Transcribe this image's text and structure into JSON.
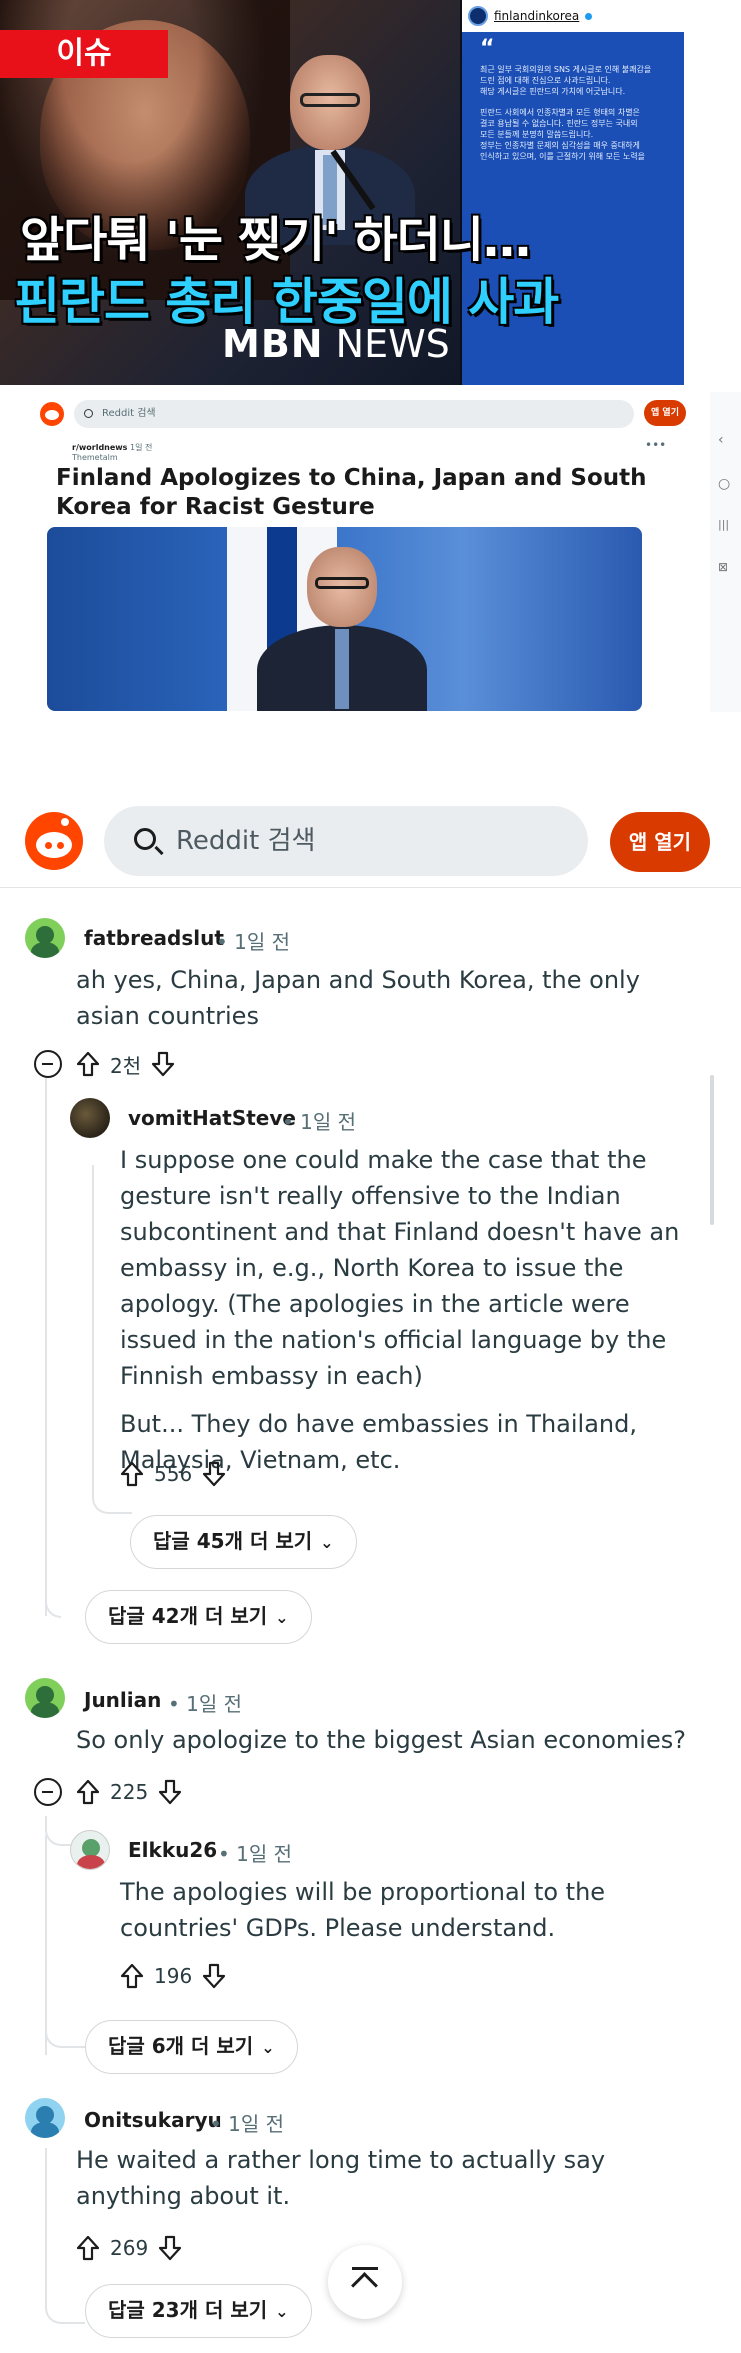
{
  "news_image": {
    "tag": "이슈",
    "account": "finlandinkorea",
    "quote_mark": "“",
    "statement_lines": [
      "최근 일부 국회의원의 SNS 게시글로 인해 불쾌감을",
      "드린 점에 대해 진심으로 사과드립니다.",
      "해당 게시글은 핀란드의 가치에 어긋납니다.",
      "핀란드 사회에서 인종차별과 모든 형태의 차별은",
      "결코 용납될 수 없습니다. 핀란드 정부는 국내외",
      "모든 분들께 분명히 말씀드립니다.",
      "정부는 인종차별 문제의 심각성을 매우 중대하게",
      "인식하고 있으며, 이를 근절하기 위해 모든 노력을"
    ],
    "headline_1": "앞다퉈 '눈 찢기' 하더니…",
    "headline_2": "핀란드 총리 한중일에 사과",
    "broadcaster_bold": "MBN",
    "broadcaster_rest": " NEWS"
  },
  "inner_screenshot": {
    "search_placeholder": "Reddit 검색",
    "open_app": "앱 열기",
    "subreddit": "r/worldnews",
    "age": "1일 전",
    "poster": "Themetalm",
    "title": "Finland Apologizes to China, Japan and South Korea for Racist Gesture",
    "side_icons": [
      "‹",
      "○",
      "|||",
      "⊠"
    ]
  },
  "header": {
    "search_placeholder": "Reddit 검색",
    "open_app": "앱 열기"
  },
  "comments": [
    {
      "user": "fatbreadslut",
      "age": "• 1일 전",
      "text": "ah yes, China, Japan and South Korea, the only asian countries",
      "votes": "2천"
    },
    {
      "user": "vomitHatSteve",
      "age": "• 1일 전",
      "text1": "I suppose one could make the case that the gesture isn't really offensive to the Indian subcontinent and that Finland doesn't have an embassy in, e.g., North Korea to issue the apology. (The apologies in the article were issued in the nation's official language by the Finnish embassy in each)",
      "text2": "But... They do have embassies in Thailand, Malaysia, Vietnam, etc.",
      "votes": "556",
      "more": "답글 45개 더 보기"
    },
    {
      "more": "답글 42개 더 보기"
    },
    {
      "user": "Junlian",
      "age": "• 1일 전",
      "text": "So only apologize to the biggest Asian economies?",
      "votes": "225"
    },
    {
      "user": "Elkku26",
      "age": "• 1일 전",
      "text": "The apologies will be proportional to the countries' GDPs. Please understand.",
      "votes": "196",
      "more": "답글 6개 더 보기"
    },
    {
      "user": "Onitsukaryu",
      "age": "• 1일 전",
      "text": "He waited a rather long time to actually say anything about it.",
      "votes": "269",
      "more": "답글 23개 더 보기"
    }
  ],
  "icons": {
    "chevron": "⌄"
  }
}
